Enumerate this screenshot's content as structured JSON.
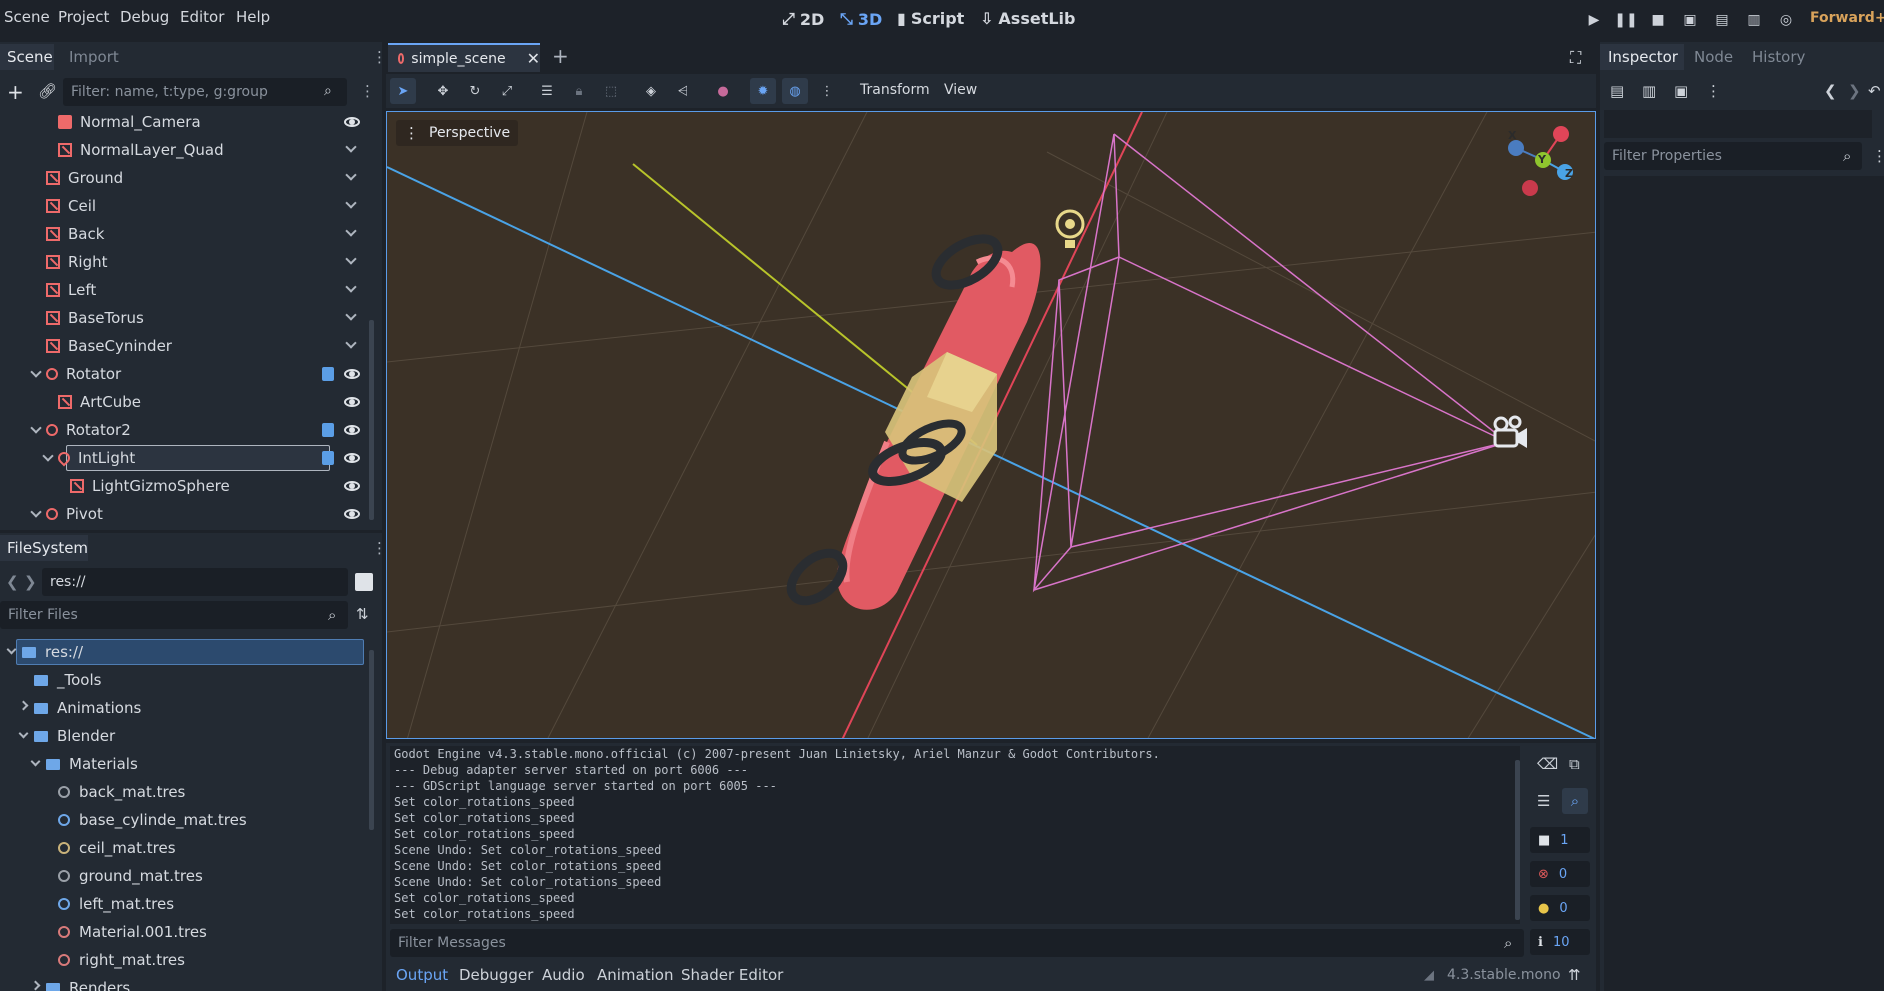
{
  "menu": [
    "Scene",
    "Project",
    "Debug",
    "Editor",
    "Help"
  ],
  "workspaces": [
    "2D",
    "3D",
    "Script",
    "AssetLib"
  ],
  "active_workspace": "3D",
  "renderer": "Forward+",
  "scene_dock": {
    "tabs": [
      "Scene",
      "Import"
    ],
    "filter_placeholder": "Filter: name, t:type, g:group",
    "nodes": [
      {
        "name": "Normal_Camera",
        "indent": 2,
        "icon": "camera-icon",
        "visible": true
      },
      {
        "name": "NormalLayer_Quad",
        "indent": 2,
        "icon": "mesh-icon",
        "visible": false
      },
      {
        "name": "Ground",
        "indent": 1,
        "icon": "mesh-icon",
        "visible": false
      },
      {
        "name": "Ceil",
        "indent": 1,
        "icon": "mesh-icon",
        "visible": false
      },
      {
        "name": "Back",
        "indent": 1,
        "icon": "mesh-icon",
        "visible": false
      },
      {
        "name": "Right",
        "indent": 1,
        "icon": "mesh-icon",
        "visible": false
      },
      {
        "name": "Left",
        "indent": 1,
        "icon": "mesh-icon",
        "visible": false
      },
      {
        "name": "BaseTorus",
        "indent": 1,
        "icon": "mesh-icon",
        "visible": false
      },
      {
        "name": "BaseCyninder",
        "indent": 1,
        "icon": "mesh-icon",
        "visible": false
      },
      {
        "name": "Rotator",
        "indent": 1,
        "icon": "node3d-icon",
        "visible": true,
        "script": true,
        "expanded": true
      },
      {
        "name": "ArtCube",
        "indent": 2,
        "icon": "mesh-icon",
        "visible": true
      },
      {
        "name": "Rotator2",
        "indent": 1,
        "icon": "node3d-icon",
        "visible": true,
        "script": true,
        "expanded": true
      },
      {
        "name": "IntLight",
        "indent": 2,
        "icon": "light-icon",
        "visible": true,
        "script": true,
        "expanded": true,
        "selected": true
      },
      {
        "name": "LightGizmoSphere",
        "indent": 3,
        "icon": "mesh-icon",
        "visible": true
      },
      {
        "name": "Pivot",
        "indent": 1,
        "icon": "node3d-icon",
        "visible": true,
        "expanded": true
      }
    ]
  },
  "filesystem": {
    "title": "FileSystem",
    "path": "res://",
    "filter_placeholder": "Filter Files",
    "items": [
      {
        "name": "res://",
        "indent": 0,
        "type": "folder",
        "selected": true,
        "expanded": true
      },
      {
        "name": "_Tools",
        "indent": 1,
        "type": "folder"
      },
      {
        "name": "Animations",
        "indent": 1,
        "type": "folder",
        "collapsed": true
      },
      {
        "name": "Blender",
        "indent": 1,
        "type": "folder",
        "expanded": true
      },
      {
        "name": "Materials",
        "indent": 2,
        "type": "folder",
        "expanded": true
      },
      {
        "name": "back_mat.tres",
        "indent": 3,
        "type": "res",
        "color": "#9aa0a8"
      },
      {
        "name": "base_cylinde_mat.tres",
        "indent": 3,
        "type": "res",
        "color": "#6ea7e8"
      },
      {
        "name": "ceil_mat.tres",
        "indent": 3,
        "type": "res",
        "color": "#c9b27a"
      },
      {
        "name": "ground_mat.tres",
        "indent": 3,
        "type": "res",
        "color": "#9aa0a8"
      },
      {
        "name": "left_mat.tres",
        "indent": 3,
        "type": "res",
        "color": "#6ea7e8"
      },
      {
        "name": "Material.001.tres",
        "indent": 3,
        "type": "res",
        "color": "#d87a7a"
      },
      {
        "name": "right_mat.tres",
        "indent": 3,
        "type": "res",
        "color": "#d87a7a"
      },
      {
        "name": "Renders",
        "indent": 2,
        "type": "folder",
        "collapsed": true
      }
    ]
  },
  "scene_tab": {
    "name": "simple_scene"
  },
  "viewport_menu": [
    "Transform",
    "View"
  ],
  "viewport_label": "Perspective",
  "gizmo_axes": [
    "X",
    "Y",
    "Z"
  ],
  "output": {
    "lines": [
      "Godot Engine v4.3.stable.mono.official (c) 2007-present Juan Linietsky, Ariel Manzur & Godot Contributors.",
      "--- Debug adapter server started on port 6006 ---",
      "--- GDScript language server started on port 6005 ---",
      "Set color_rotations_speed",
      "Set color_rotations_speed",
      "Set color_rotations_speed",
      "Scene Undo: Set color_rotations_speed",
      "Scene Undo: Set color_rotations_speed",
      "Scene Undo: Set color_rotations_speed",
      "Set color_rotations_speed",
      "Set color_rotations_speed"
    ],
    "filter_placeholder": "Filter Messages",
    "counts": {
      "messages": "1",
      "errors": "0",
      "warnings": "0",
      "info": "10"
    }
  },
  "bottom_tabs": [
    "Output",
    "Debugger",
    "Audio",
    "Animation",
    "Shader Editor"
  ],
  "version": "4.3.stable.mono",
  "inspector": {
    "tabs": [
      "Inspector",
      "Node",
      "History"
    ],
    "filter_placeholder": "Filter Properties"
  },
  "colors": {
    "accent": "#6aa5f5",
    "node_red": "#ee6a6a",
    "viewport_bg": "#3b3126"
  }
}
